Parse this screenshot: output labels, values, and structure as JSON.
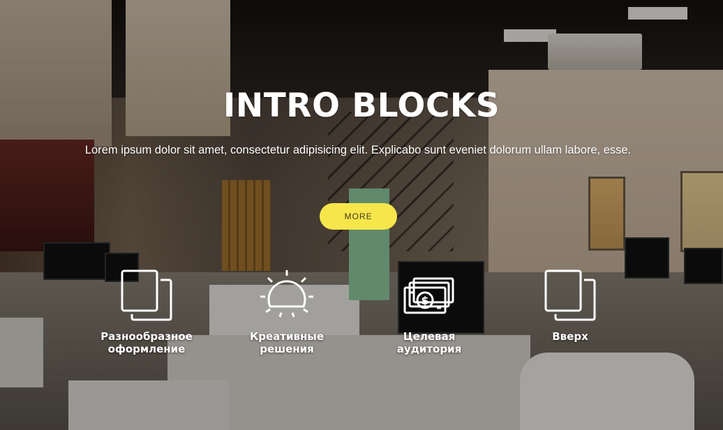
{
  "hero": {
    "title": "INTRO BLOCKS",
    "lead": "Lorem ipsum dolor sit amet, consectetur adipisicing elit. Explicabo sunt eveniet dolorum ullam labore, esse.",
    "button_label": "MORE",
    "accent_color": "#f7e64b"
  },
  "features": [
    {
      "label": "Разнообразное оформление",
      "icon": "layers-icon"
    },
    {
      "label": "Креативные решения",
      "icon": "sun-icon"
    },
    {
      "label": "Целевая аудитория",
      "icon": "money-icon"
    },
    {
      "label": "Вверх",
      "icon": "layers-icon"
    }
  ]
}
